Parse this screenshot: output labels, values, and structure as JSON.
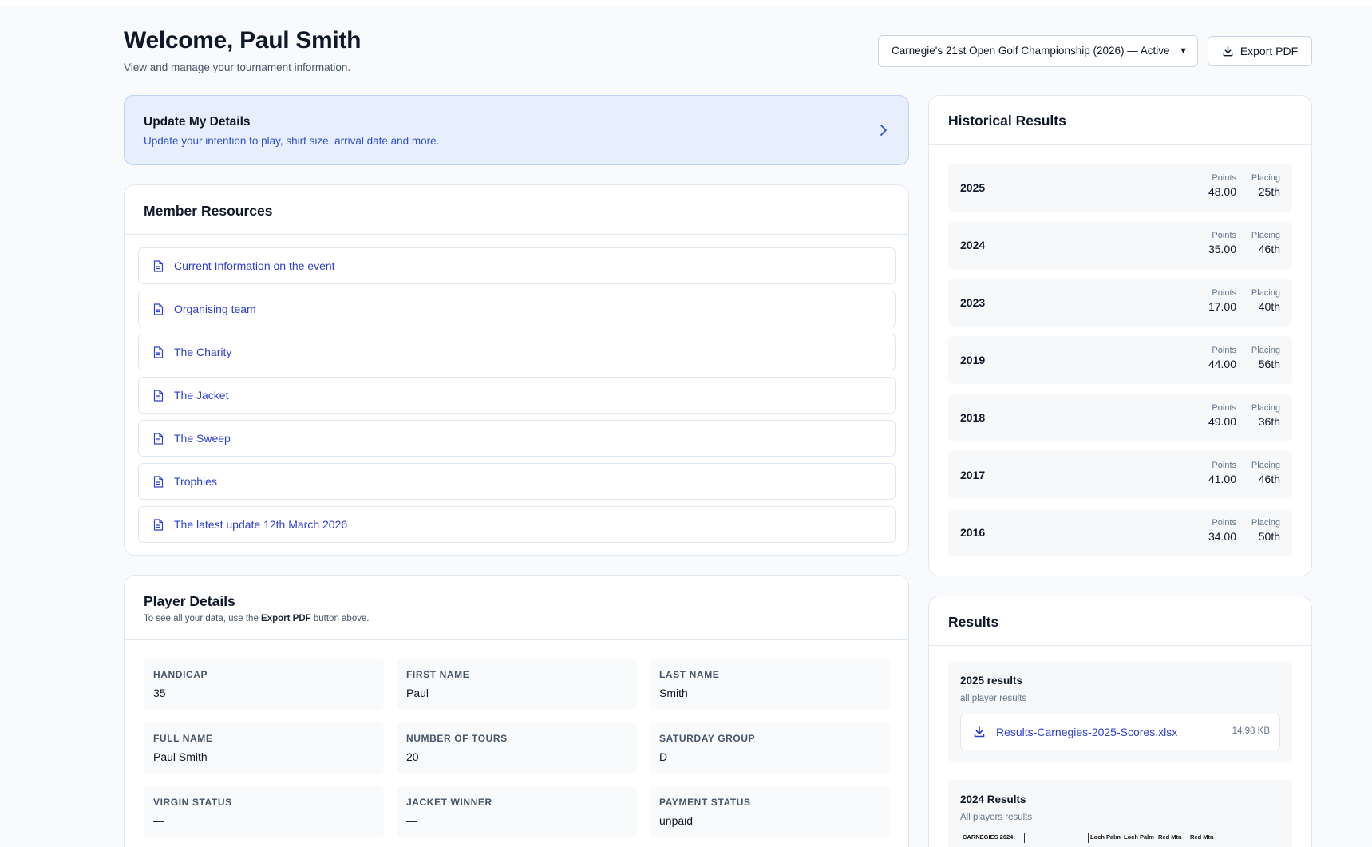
{
  "header": {
    "welcome": "Welcome, Paul Smith",
    "subtitle": "View and manage your tournament information.",
    "tournament_select": "Carnegie's 21st Open Golf Championship (2026) — Active",
    "export_label": "Export PDF"
  },
  "update": {
    "title": "Update My Details",
    "description": "Update your intention to play, shirt size, arrival date and more."
  },
  "resources": {
    "title": "Member Resources",
    "items": [
      "Current Information on the event",
      "Organising team",
      "The Charity",
      "The Jacket",
      "The Sweep",
      "Trophies",
      "The latest update 12th March 2026"
    ]
  },
  "player": {
    "title": "Player Details",
    "note_before": "To see all your data, use the ",
    "note_bold": "Export PDF",
    "note_after": " button above.",
    "fields": [
      {
        "label": "HANDICAP",
        "value": "35"
      },
      {
        "label": "FIRST NAME",
        "value": "Paul"
      },
      {
        "label": "LAST NAME",
        "value": "Smith"
      },
      {
        "label": "FULL NAME",
        "value": "Paul Smith"
      },
      {
        "label": "NUMBER OF TOURS",
        "value": "20"
      },
      {
        "label": "SATURDAY GROUP",
        "value": "D"
      },
      {
        "label": "VIRGIN STATUS",
        "value": "—"
      },
      {
        "label": "JACKET WINNER",
        "value": "—"
      },
      {
        "label": "PAYMENT STATUS",
        "value": "unpaid"
      }
    ]
  },
  "history": {
    "title": "Historical Results",
    "points_label": "Points",
    "placing_label": "Placing",
    "rows": [
      {
        "year": "2025",
        "points": "48.00",
        "placing": "25th"
      },
      {
        "year": "2024",
        "points": "35.00",
        "placing": "46th"
      },
      {
        "year": "2023",
        "points": "17.00",
        "placing": "40th"
      },
      {
        "year": "2019",
        "points": "44.00",
        "placing": "56th"
      },
      {
        "year": "2018",
        "points": "49.00",
        "placing": "36th"
      },
      {
        "year": "2017",
        "points": "41.00",
        "placing": "46th"
      },
      {
        "year": "2016",
        "points": "34.00",
        "placing": "50th"
      }
    ]
  },
  "results": {
    "title": "Results",
    "blocks": [
      {
        "title": "2025 results",
        "subtitle": "all player results",
        "file_name": "Results-Carnegies-2025-Scores.xlsx",
        "file_size": "14.98 KB"
      },
      {
        "title": "2024 Results",
        "subtitle": "All players results",
        "preview_label": "CARNEGIES 2024:",
        "preview_cols": [
          "Loch Palm",
          "Loch Palm",
          "Red Mtn",
          "Red Mtn"
        ]
      }
    ]
  },
  "colors": {
    "accent": "#2f3fcf",
    "update_bg": "#e8effc",
    "page_bg": "#f8fafc"
  }
}
